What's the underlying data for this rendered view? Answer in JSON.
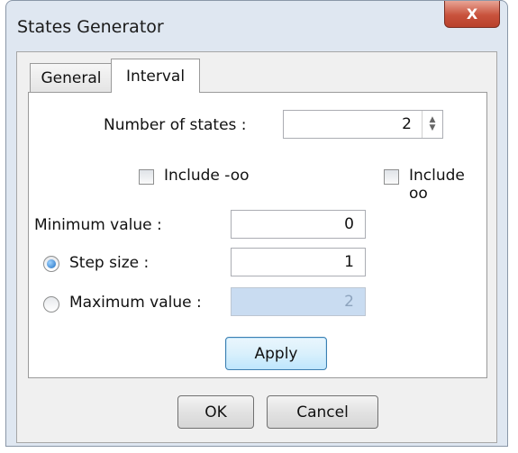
{
  "window": {
    "title": "States Generator",
    "close_label": "X"
  },
  "tabs": {
    "general": "General",
    "interval": "Interval"
  },
  "number_of_states": {
    "label": "Number of states :",
    "value": "2"
  },
  "include_neg_inf": {
    "label": "Include -oo",
    "checked": false
  },
  "include_pos_inf": {
    "label": "Include oo",
    "checked": false
  },
  "minimum": {
    "label": "Minimum value :",
    "value": "0"
  },
  "step": {
    "label": "Step size :",
    "value": "1",
    "selected": true
  },
  "maximum": {
    "label": "Maximum value :",
    "value": "2",
    "selected": false,
    "disabled": true
  },
  "buttons": {
    "apply": "Apply",
    "ok": "OK",
    "cancel": "Cancel"
  }
}
